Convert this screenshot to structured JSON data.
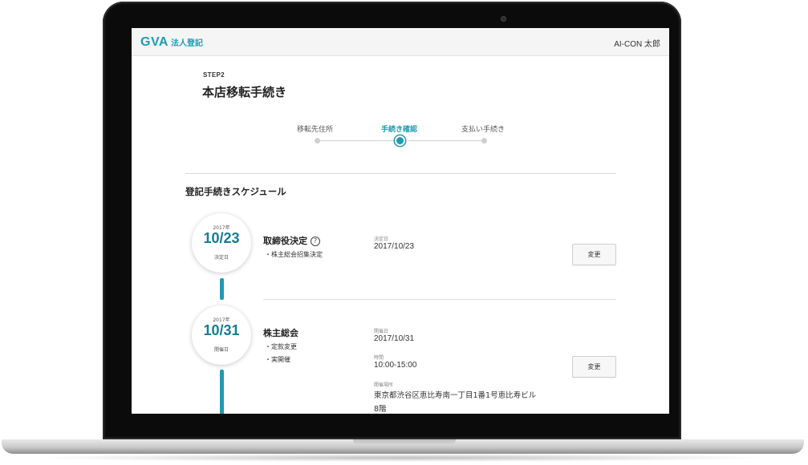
{
  "app": {
    "logo": "GVA",
    "logo_sub": "法人登記",
    "user_name": "AI-CON 太郎"
  },
  "page": {
    "step_label": "STEP2",
    "title": "本店移転手続き"
  },
  "stepper": {
    "steps": [
      {
        "label": "移転先住所",
        "state": "inactive"
      },
      {
        "label": "手続き確認",
        "state": "active"
      },
      {
        "label": "支払い手続き",
        "state": "inactive"
      }
    ]
  },
  "schedule": {
    "title": "登記手続きスケジュール",
    "events": [
      {
        "year": "2017年",
        "month_day": "10/23",
        "date_label": "決定日",
        "title": "取締役決定",
        "help_icon": "?",
        "bullets": [
          "・株主総会招集決定"
        ],
        "fields": [
          {
            "label": "決定日",
            "value": "2017/10/23"
          }
        ],
        "button": "変更"
      },
      {
        "year": "2017年",
        "month_day": "10/31",
        "date_label": "開催日",
        "title": "株主総会",
        "bullets": [
          "・定款変更",
          "・実開催"
        ],
        "fields": [
          {
            "label": "開催日",
            "value": "2017/10/31"
          },
          {
            "label": "時間",
            "value": "10:00-15:00"
          },
          {
            "label": "開催場所",
            "value": "東京都渋谷区恵比寿南一丁目1番1号恵比寿ビル",
            "value2": "8階"
          }
        ],
        "button": "変更"
      }
    ]
  },
  "colors": {
    "accent": "#1e9bb2",
    "date_text": "#147d93",
    "app_bar": "#f5f5f5",
    "laptop_bezel": "#0b0b0b"
  }
}
